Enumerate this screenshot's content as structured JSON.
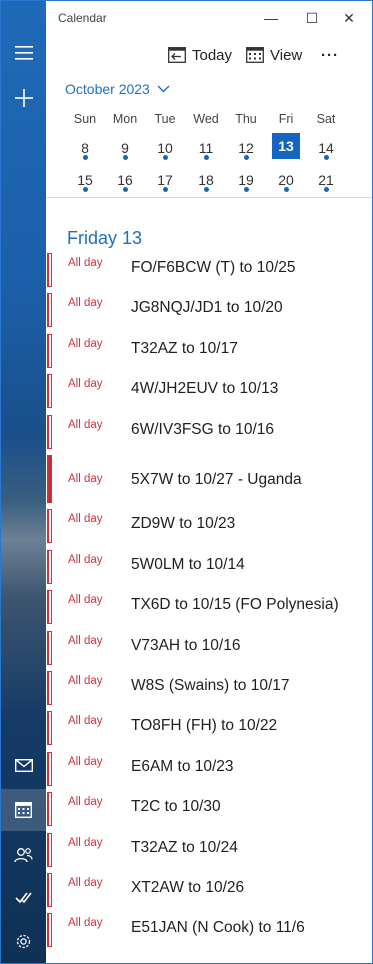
{
  "app": {
    "title": "Calendar"
  },
  "window": {
    "minimize": "—",
    "maximize": "☐",
    "close": "✕"
  },
  "toolbar": {
    "today_label": "Today",
    "view_label": "View",
    "more_label": "···"
  },
  "month": {
    "label": "October 2023"
  },
  "weekdays": [
    "Sun",
    "Mon",
    "Tue",
    "Wed",
    "Thu",
    "Fri",
    "Sat"
  ],
  "weeks": [
    [
      "8",
      "9",
      "10",
      "11",
      "12",
      "13",
      "14"
    ],
    [
      "15",
      "16",
      "17",
      "18",
      "19",
      "20",
      "21"
    ]
  ],
  "selected_day": "13",
  "day_header": "Friday 13",
  "events": [
    {
      "label": "All day",
      "title": "FO/F6BCW (T) to 10/25",
      "filled": false
    },
    {
      "label": "All day",
      "title": "JG8NQJ/JD1 to 10/20",
      "filled": false
    },
    {
      "label": "All day",
      "title": "T32AZ to 10/17",
      "filled": false
    },
    {
      "label": "All day",
      "title": "4W/JH2EUV to 10/13",
      "filled": false
    },
    {
      "label": "All day",
      "title": "6W/IV3FSG to 10/16",
      "filled": false
    },
    {
      "label": "All day",
      "title": "5X7W to 10/27 - Uganda",
      "filled": true
    },
    {
      "label": "All day",
      "title": "ZD9W to 10/23",
      "filled": false
    },
    {
      "label": "All day",
      "title": "5W0LM to 10/14",
      "filled": false
    },
    {
      "label": "All day",
      "title": "TX6D to 10/15 (FO Polynesia)",
      "filled": false
    },
    {
      "label": "All day",
      "title": "V73AH to 10/16",
      "filled": false
    },
    {
      "label": "All day",
      "title": "W8S (Swains) to 10/17",
      "filled": false
    },
    {
      "label": "All day",
      "title": "TO8FH (FH) to 10/22",
      "filled": false
    },
    {
      "label": "All day",
      "title": "E6AM to 10/23",
      "filled": false
    },
    {
      "label": "All day",
      "title": "T2C to 10/30",
      "filled": false
    },
    {
      "label": "All day",
      "title": "T32AZ to 10/24",
      "filled": false
    },
    {
      "label": "All day",
      "title": "XT2AW to 10/26",
      "filled": false
    },
    {
      "label": "All day",
      "title": "E51JAN (N Cook) to 11/6",
      "filled": false
    }
  ],
  "rail": {
    "top": [
      "hamburger-icon",
      "plus-icon"
    ],
    "bottom": [
      "mail-icon",
      "calendar-icon",
      "people-icon",
      "todo-icon",
      "settings-icon"
    ]
  },
  "colors": {
    "accent": "#1e6fc2",
    "today_bg": "#1565c0",
    "event_red": "#d0313c"
  }
}
